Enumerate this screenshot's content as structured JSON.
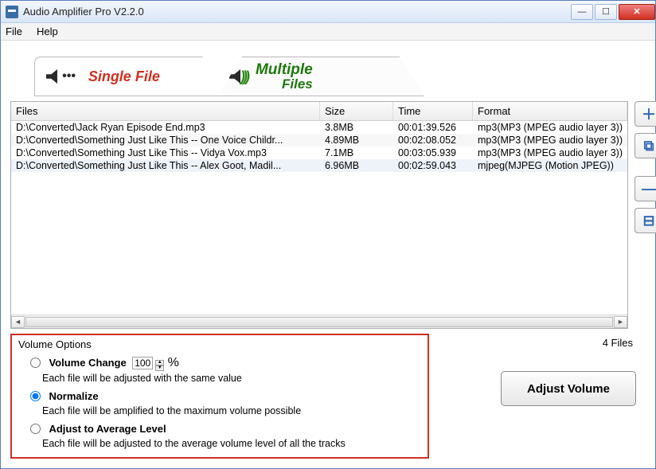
{
  "window": {
    "title": "Audio Amplifier Pro V2.2.0"
  },
  "menubar": {
    "file": "File",
    "help": "Help"
  },
  "tabs": {
    "single": "Single File",
    "multiple_top": "Multiple",
    "multiple_bot": "Files"
  },
  "win_controls": {
    "min": "—",
    "max": "☐",
    "close": "✕"
  },
  "list": {
    "headers": {
      "files": "Files",
      "size": "Size",
      "time": "Time",
      "format": "Format"
    },
    "rows": [
      {
        "file": "D:\\Converted\\Jack Ryan Episode End.mp3",
        "size": "3.8MB",
        "time": "00:01:39.526",
        "format": "mp3(MP3 (MPEG audio layer 3))"
      },
      {
        "file": "D:\\Converted\\Something Just Like This -- One Voice Childr...",
        "size": "4.89MB",
        "time": "00:02:08.052",
        "format": "mp3(MP3 (MPEG audio layer 3))"
      },
      {
        "file": "D:\\Converted\\Something Just Like This -- Vidya Vox.mp3",
        "size": "7.1MB",
        "time": "00:03:05.939",
        "format": "mp3(MP3 (MPEG audio layer 3))"
      },
      {
        "file": "D:\\Converted\\Something Just Like This -- Alex Goot, Madil...",
        "size": "6.96MB",
        "time": "00:02:59.043",
        "format": "mjpeg(MJPEG (Motion JPEG))"
      }
    ],
    "selected_index": 3
  },
  "sidebar": {
    "add_file": "＋",
    "add_folder": "⧉",
    "remove": "—",
    "clear": "⊟"
  },
  "footer": {
    "count_label": "4 Files",
    "adjust_btn": "Adjust Volume"
  },
  "options": {
    "title": "Volume Options",
    "selected": "normalize",
    "volume_change": {
      "label": "Volume Change",
      "value": "100",
      "suffix": "%",
      "desc": "Each file will be adjusted with the same value"
    },
    "normalize": {
      "label": "Normalize",
      "desc": "Each file will be amplified to the maximum volume possible"
    },
    "average": {
      "label": "Adjust to Average Level",
      "desc": "Each file will be adjusted to the average volume level of all the tracks"
    }
  }
}
